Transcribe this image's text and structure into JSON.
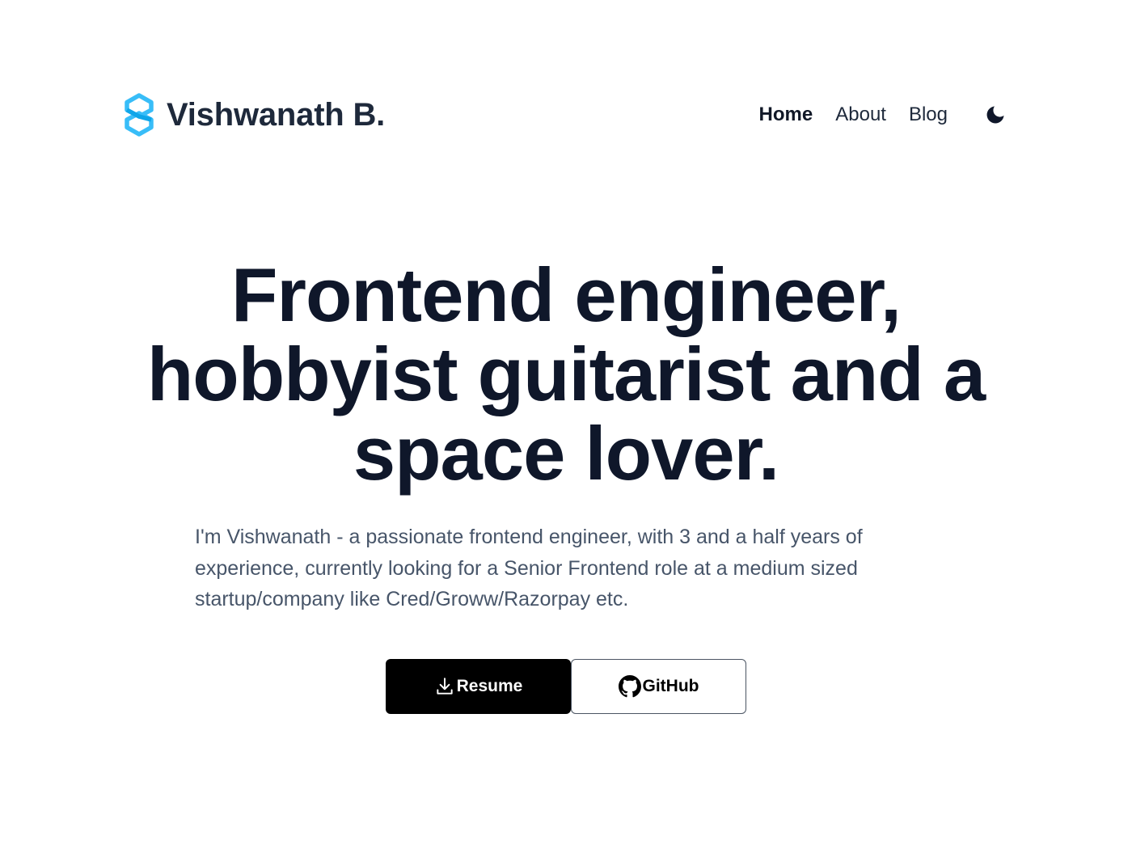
{
  "header": {
    "brand_name": "Vishwanath B.",
    "logo_icon": "hexagon-s-logo-icon",
    "nav": [
      {
        "label": "Home",
        "active": true
      },
      {
        "label": "About",
        "active": false
      },
      {
        "label": "Blog",
        "active": false
      }
    ],
    "theme_toggle_icon": "moon-icon"
  },
  "hero": {
    "title_line1": "Frontend engineer,",
    "title_line2": "hobbyist guitarist and a",
    "title_line3": "space lover.",
    "description": "I'm Vishwanath - a passionate frontend engineer, with 3 and a half years of experience, currently looking for a Senior Frontend role at a medium sized startup/company like Cred/Groww/Razorpay etc."
  },
  "actions": {
    "resume_label": "Resume",
    "resume_icon": "download-icon",
    "github_label": "GitHub",
    "github_icon": "github-icon"
  },
  "colors": {
    "logo_light": "#38bdf8",
    "logo_dark": "#0ea5e9",
    "heading": "#0f172a",
    "body_text": "#475569",
    "primary_button": "#000000"
  }
}
